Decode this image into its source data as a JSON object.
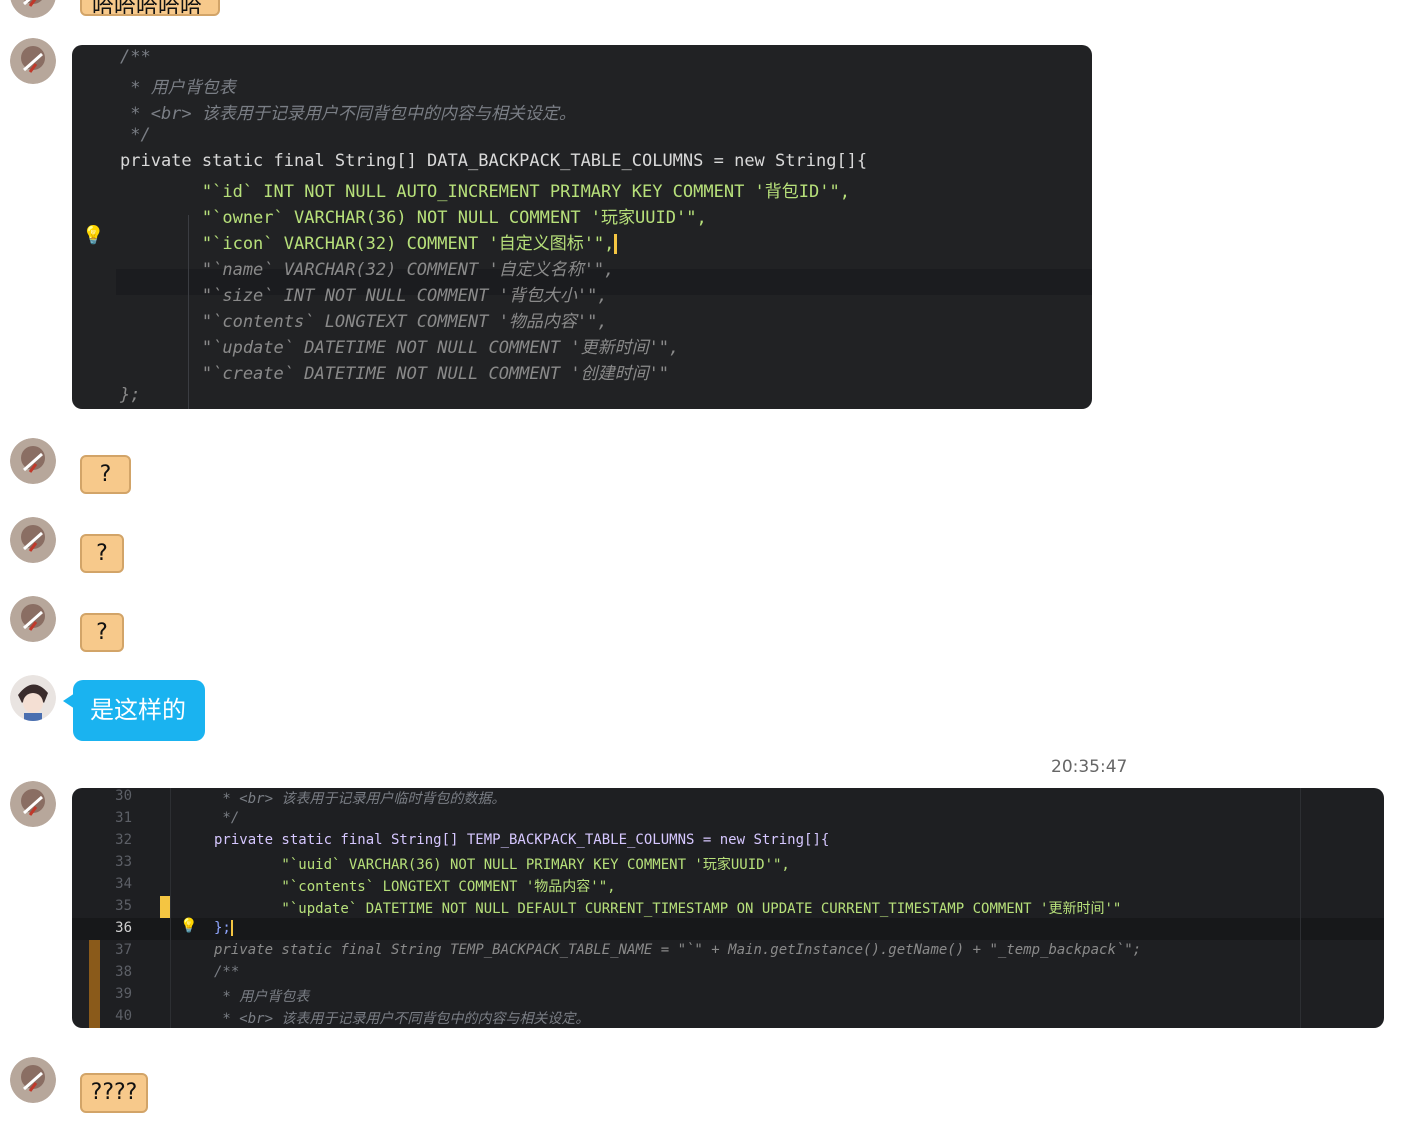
{
  "chat": {
    "top_bubble_text": "哈哈哈哈哈",
    "code1": {
      "lines": [
        "/**",
        " * 用户背包表",
        " * <br> 该表用于记录用户不同背包中的内容与相关设定。",
        " */",
        "private static final String[] DATA_BACKPACK_TABLE_COLUMNS = new String[]{",
        "        \"`id` INT NOT NULL AUTO_INCREMENT PRIMARY KEY COMMENT '背包ID'\",",
        "        \"`owner` VARCHAR(36) NOT NULL COMMENT '玩家UUID'\",",
        "        \"`icon` VARCHAR(32) COMMENT '自定义图标'\",",
        "        \"`name` VARCHAR(32) COMMENT '自定义名称'\",",
        "        \"`size` INT NOT NULL COMMENT '背包大小'\",",
        "        \"`contents` LONGTEXT COMMENT '物品内容'\",",
        "        \"`update` DATETIME NOT NULL COMMENT '更新时间'\",",
        "        \"`create` DATETIME NOT NULL COMMENT '创建时间'\"",
        "};"
      ]
    },
    "q1": "?",
    "q2": "?",
    "q3": "?",
    "blue_message": "是这样的",
    "timestamp": "20:35:47",
    "code2": {
      "line_numbers": [
        "30",
        "31",
        "32",
        "33",
        "34",
        "35",
        "36",
        "37",
        "38",
        "39",
        "40"
      ],
      "lines": [
        " * <br> 该表用于记录用户临时背包的数据。",
        " */",
        "private static final String[] TEMP_BACKPACK_TABLE_COLUMNS = new String[]{",
        "        \"`uuid` VARCHAR(36) NOT NULL PRIMARY KEY COMMENT '玩家UUID'\",",
        "        \"`contents` LONGTEXT COMMENT '物品内容'\",",
        "        \"`update` DATETIME NOT NULL DEFAULT CURRENT_TIMESTAMP ON UPDATE CURRENT_TIMESTAMP COMMENT '更新时间'\"",
        "};",
        "private static final String TEMP_BACKPACK_TABLE_NAME = \"`\" + Main.getInstance().getName() + \"_temp_backpack`\";",
        "/**",
        " * 用户背包表",
        " * <br> 该表用于记录用户不同背包中的内容与相关设定。"
      ]
    },
    "last_bubble": "????",
    "colors": {
      "bubble_bg": "#f7c98b",
      "blue_bubble_bg": "#1ab3f0",
      "code_bg": "#1e1f22"
    }
  }
}
